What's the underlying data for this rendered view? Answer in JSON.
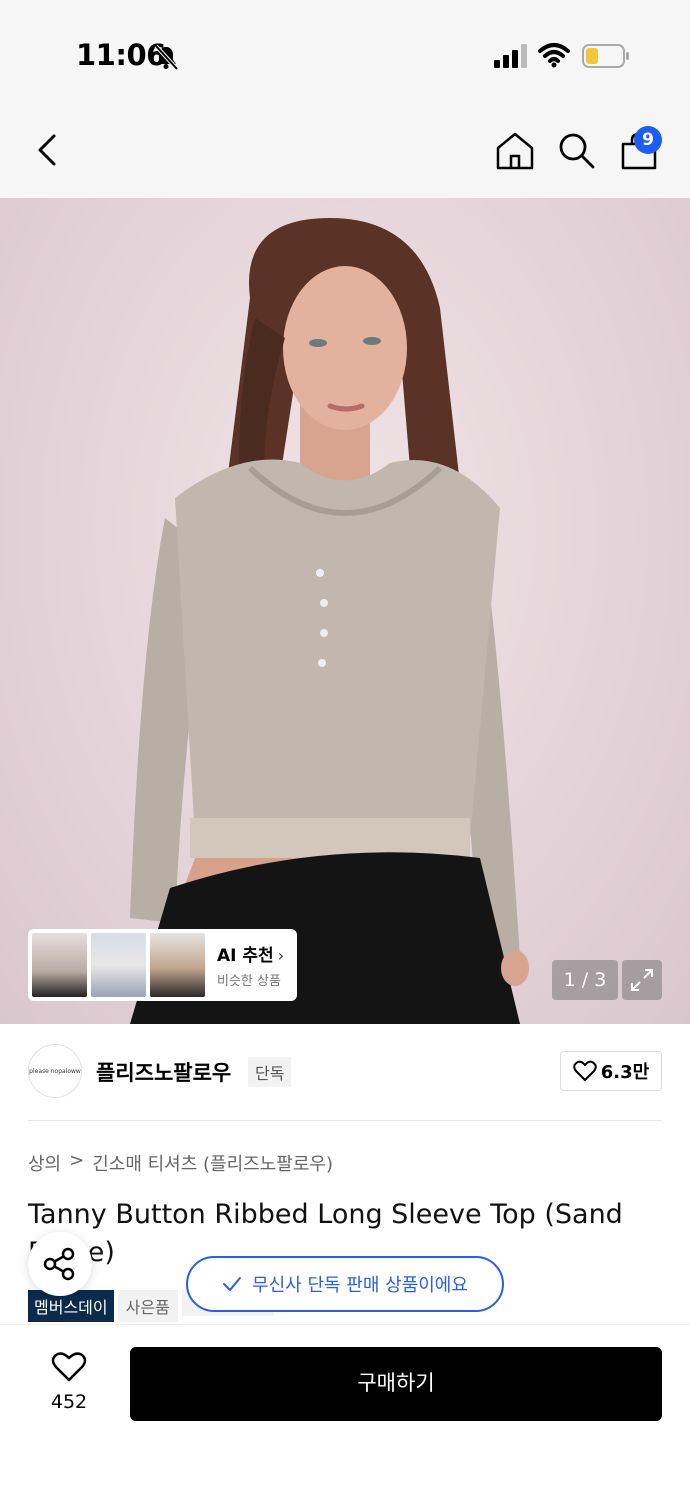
{
  "status_bar": {
    "time": "11:06"
  },
  "nav": {
    "cart_count": "9"
  },
  "gallery": {
    "page_indicator": "1 / 3",
    "ai_card": {
      "title": "AI 추천",
      "subtitle": "비슷한 상품"
    }
  },
  "brand": {
    "logo_text": "please nopaloww",
    "name": "플리즈노팔로우",
    "tag": "단독",
    "likes": "6.3만"
  },
  "breadcrumb": {
    "category": "상의",
    "separator": ">",
    "subcategory": "긴소매 티셔츠 (플리즈노팔로우)"
  },
  "product": {
    "title": "Tanny Button Ribbed Long Sleeve Top (Sand Beige)",
    "tags": [
      "멤버스데이",
      "사은품"
    ]
  },
  "toast": {
    "message": "무신사 단독 판매 상품이에요"
  },
  "bottom_bar": {
    "wish_count": "452",
    "buy_label": "구매하기"
  },
  "colors": {
    "accent": "#1e5cf2",
    "toast": "#2a5ee8",
    "member_tag": "#0c2b4c"
  }
}
